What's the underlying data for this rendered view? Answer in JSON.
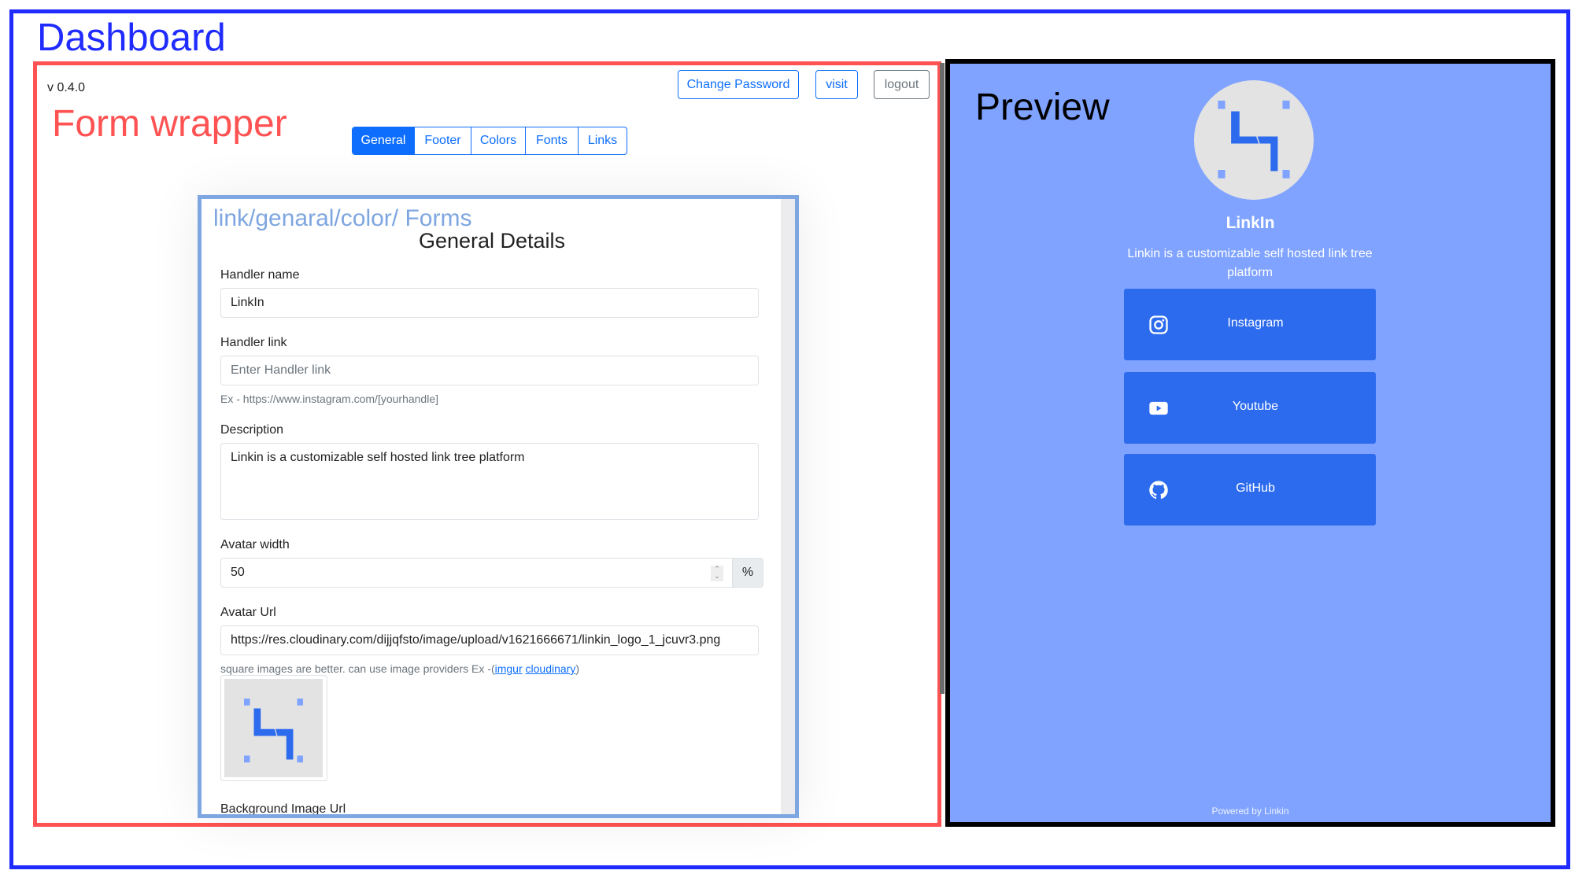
{
  "annotations": {
    "dashboard": "Dashboard",
    "form_wrapper": "Form wrapper",
    "preview": "Preview",
    "form_breadcrumb": "link/genaral/color/ Forms"
  },
  "colors": {
    "dashboard_border": "#1f2bff",
    "form_wrapper_border": "#ff5252",
    "form_card_border": "#7ea6e0",
    "preview_background": "#7fa3ff",
    "link_button": "#2d6bee",
    "primary": "#0d6efd"
  },
  "header": {
    "version": "v 0.4.0",
    "buttons": {
      "change_password": "Change Password",
      "visit": "visit",
      "logout": "logout"
    }
  },
  "tabs": [
    {
      "label": "General",
      "active": true
    },
    {
      "label": "Footer",
      "active": false
    },
    {
      "label": "Colors",
      "active": false
    },
    {
      "label": "Fonts",
      "active": false
    },
    {
      "label": "Links",
      "active": false
    }
  ],
  "form": {
    "title": "General Details",
    "handler_name": {
      "label": "Handler name",
      "value": "LinkIn"
    },
    "handler_link": {
      "label": "Handler link",
      "value": "",
      "placeholder": "Enter Handler link",
      "help": "Ex - https://www.instagram.com/[yourhandle]"
    },
    "description": {
      "label": "Description",
      "value": "Linkin is a customizable self hosted link tree platform"
    },
    "avatar_width": {
      "label": "Avatar width",
      "value": "50",
      "unit": "%"
    },
    "avatar_url": {
      "label": "Avatar Url",
      "value": "https://res.cloudinary.com/dijjqfsto/image/upload/v1621666671/linkin_logo_1_jcuvr3.png",
      "help_prefix": "square images are better. can use image providers Ex -(",
      "help_link_1": "imgur",
      "help_link_2": "cloudinary",
      "help_suffix": ")"
    },
    "background_image_url": {
      "label": "Background Image Url"
    }
  },
  "preview": {
    "name": "LinkIn",
    "description": "Linkin is a customizable self hosted link tree platform",
    "links": [
      {
        "label": "Instagram",
        "icon": "instagram-icon"
      },
      {
        "label": "Youtube",
        "icon": "youtube-icon"
      },
      {
        "label": "GitHub",
        "icon": "github-icon"
      }
    ],
    "footer": "Powered by Linkin"
  }
}
